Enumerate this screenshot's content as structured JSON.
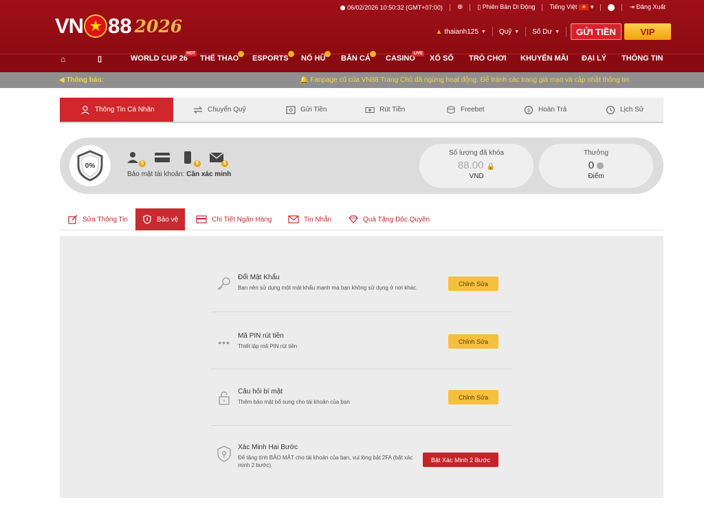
{
  "brand": {
    "prefix": "VN",
    "digits": "88",
    "year": "2026"
  },
  "topbar": {
    "datetime": "06/02/2026 10:50:32 (GMT+07:00)",
    "mobile": "Phiên Bản Di Động",
    "language": "Tiếng Việt",
    "logout": "Đăng Xuất"
  },
  "userbar": {
    "username": "thaianh125",
    "funds": "Quỹ",
    "balance": "Số Dư",
    "deposit": "GỬI TIỀN",
    "vip": "VIP"
  },
  "nav": [
    {
      "label": "WORLD CUP 26",
      "badge": "HOT"
    },
    {
      "label": "THỂ THAO",
      "badge": ""
    },
    {
      "label": "ESPORTS",
      "badge": ""
    },
    {
      "label": "NỔ HŨ",
      "badge": ""
    },
    {
      "label": "BẮN CÁ",
      "badge": ""
    },
    {
      "label": "CASINO",
      "badge": "LIVE"
    },
    {
      "label": "XỔ SỐ",
      "badge": ""
    },
    {
      "label": "TRÒ CHƠI",
      "badge": ""
    },
    {
      "label": "KHUYẾN MÃI",
      "badge": ""
    },
    {
      "label": "ĐẠI LÝ",
      "badge": ""
    },
    {
      "label": "THÔNG TIN",
      "badge": ""
    }
  ],
  "notice": {
    "label": "Thông báo:",
    "message": "Fanpage cũ của VN88 Trang Chủ đã ngừng hoạt động. Để tránh các trang giả mạo và cập nhật thông tin"
  },
  "account_tabs": [
    {
      "label": "Thông Tin Cá Nhân",
      "active": true
    },
    {
      "label": "Chuyển Quỹ",
      "active": false
    },
    {
      "label": "Gửi Tiền",
      "active": false
    },
    {
      "label": "Rút Tiền",
      "active": false
    },
    {
      "label": "Freebet",
      "active": false
    },
    {
      "label": "Hoàn Trả",
      "active": false
    },
    {
      "label": "Lịch Sử",
      "active": false
    }
  ],
  "security": {
    "percent": "0%",
    "label": "Bảo mật tài khoản:",
    "status": "Cần xác minh"
  },
  "locked": {
    "title": "Số lượng đã khóa",
    "value": "88.00",
    "unit": "VND"
  },
  "reward": {
    "title": "Thưởng",
    "value": "0",
    "unit": "Điểm"
  },
  "profile_tabs": [
    {
      "label": "Sửa Thông Tin",
      "active": false
    },
    {
      "label": "Bảo vệ",
      "active": true
    },
    {
      "label": "Chi Tiết Ngân Hàng",
      "active": false
    },
    {
      "label": "Tin Nhắn",
      "active": false
    },
    {
      "label": "Quà Tặng Độc Quyền",
      "active": false
    }
  ],
  "security_items": [
    {
      "icon": "key-icon",
      "title": "Đổi Mật Khẩu",
      "desc": "Bạn nên sử dụng một mật khẩu mạnh mà bạn không sử dụng ở nơi khác.",
      "button": "Chỉnh Sửa"
    },
    {
      "icon": "pin-icon",
      "title": "Mã PIN rút tiền",
      "desc": "Thiết lập mã PIN rút tiền",
      "button": "Chỉnh Sửa"
    },
    {
      "icon": "lock-icon",
      "title": "Câu hỏi bí mật",
      "desc": "Thêm bảo mật bổ sung cho tài khoản của bạn",
      "button": "Chỉnh Sửa"
    },
    {
      "icon": "shield-icon",
      "title": "Xác Minh Hai Bước",
      "desc": "Để tăng tính BẢO MẬT cho tài khoản của bạn, vui lòng bật 2FA (bật xác minh 2 bước)",
      "button": "Bật Xác Minh 2 Bước"
    }
  ],
  "colors": {
    "brand_red": "#8d0b12",
    "accent_red": "#d0262c",
    "gold": "#f6c03e"
  }
}
